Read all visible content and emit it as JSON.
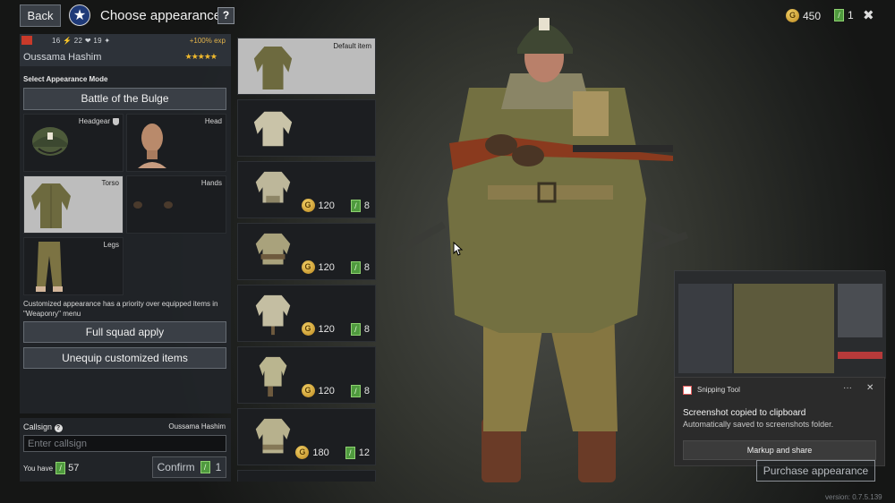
{
  "header": {
    "back_label": "Back",
    "title": "Choose appearance",
    "help_label": "?",
    "gold": "450",
    "tickets": "1",
    "close_label": "✖"
  },
  "soldier": {
    "stats": "16 ⚡  22 ❤  19 ✦",
    "exp": "+100% exp",
    "name": "Oussama Hashim",
    "stars": "★★★★★"
  },
  "appearance": {
    "mode_label": "Select Appearance Mode",
    "mode_value": "Battle of the Bulge",
    "slots": [
      {
        "label": "Headgear"
      },
      {
        "label": "Head"
      },
      {
        "label": "Torso"
      },
      {
        "label": "Hands"
      },
      {
        "label": "Legs"
      }
    ],
    "note": "Customized appearance has a priority over equipped items in \"Weaponry\" menu",
    "full_squad_label": "Full squad apply",
    "unequip_label": "Unequip customized items"
  },
  "callsign": {
    "label": "Callsign",
    "name": "Oussama Hashim",
    "placeholder": "Enter callsign",
    "you_have_label": "You have",
    "you_have_value": "57",
    "confirm_label": "Confirm",
    "confirm_cost": "1"
  },
  "items": [
    {
      "label": "Default item",
      "gold": "",
      "tickets": ""
    },
    {
      "label": "",
      "gold": "",
      "tickets": ""
    },
    {
      "label": "",
      "gold": "120",
      "tickets": "8"
    },
    {
      "label": "",
      "gold": "120",
      "tickets": "8"
    },
    {
      "label": "",
      "gold": "120",
      "tickets": "8"
    },
    {
      "label": "",
      "gold": "120",
      "tickets": "8"
    },
    {
      "label": "",
      "gold": "180",
      "tickets": "12"
    }
  ],
  "purchase_label": "Purchase appearance",
  "version": "version: 0.7.5.139",
  "toast": {
    "app": "Snipping Tool",
    "more": "···",
    "close": "✕",
    "title": "Screenshot copied to clipboard",
    "subtitle": "Automatically saved to screenshots folder.",
    "button": "Markup and share"
  },
  "colors": {
    "panel": "#222529",
    "button": "#3a3f46",
    "selected_slot": "#bdbdbd",
    "gold": "#e2b34b",
    "ticket": "#4f9a3e"
  }
}
